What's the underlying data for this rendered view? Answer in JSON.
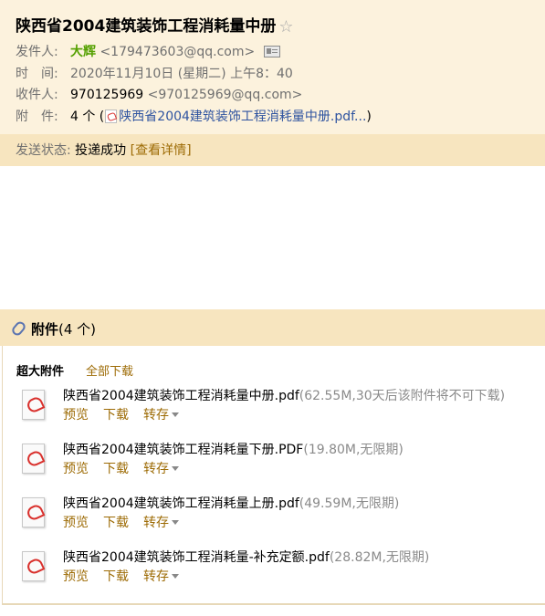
{
  "email": {
    "subject": "陕西省2004建筑装饰工程消耗量中册",
    "from_label": "发件人:",
    "from_name": "大辉",
    "from_email": "<179473603@qq.com>",
    "time_label": "时　间:",
    "time_value": "2020年11月10日 (星期二) 上午8：40",
    "to_label": "收件人:",
    "to_name": "970125969",
    "to_email": "<970125969@qq.com>",
    "attach_label": "附　件:",
    "attach_count": "4 个 (",
    "attach_preview": "陕西省2004建筑装饰工程消耗量中册.pdf...",
    "attach_close": ")"
  },
  "status": {
    "label": "发送状态:",
    "value": "投递成功",
    "detail_link": "[查看详情]"
  },
  "attachments": {
    "title": "附件",
    "count": "(4 个)",
    "big_label": "超大附件",
    "download_all": "全部下载",
    "actions": {
      "preview": "预览",
      "download": "下载",
      "save": "转存"
    },
    "items": [
      {
        "name": "陕西省2004建筑装饰工程消耗量中册.pdf",
        "meta": "(62.55M,30天后该附件将不可下载)"
      },
      {
        "name": "陕西省2004建筑装饰工程消耗量下册.PDF",
        "meta": "(19.80M,无限期)"
      },
      {
        "name": "陕西省2004建筑装饰工程消耗量上册.pdf",
        "meta": "(49.59M,无限期)"
      },
      {
        "name": "陕西省2004建筑装饰工程消耗量-补充定额.pdf",
        "meta": "(28.82M,无限期)"
      }
    ]
  },
  "icons": {
    "star": "star-icon",
    "card": "contact-card-icon",
    "pdf": "pdf-file-icon",
    "clip": "paperclip-icon",
    "caret": "chevron-down-icon"
  }
}
